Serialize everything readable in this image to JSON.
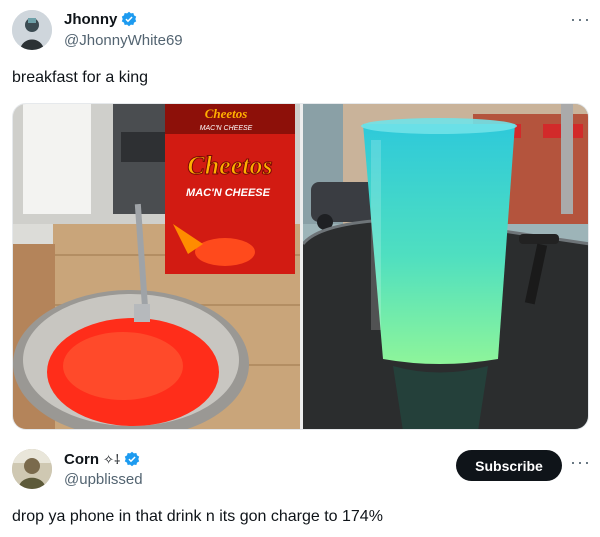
{
  "post": {
    "author_name": "Jhonny",
    "author_handle": "@JhonnyWhite69",
    "text": "breakfast for a king",
    "more_label": "···",
    "image_left": {
      "box_brand": "Cheetos",
      "box_small_brand": "Cheetos",
      "box_small_subtitle": "MAC'N CHEESE",
      "box_subtitle": "MAC'N CHEESE"
    }
  },
  "reply": {
    "author_name": "Corn",
    "author_suffix": "✧⸸",
    "author_handle": "@upblissed",
    "text": "drop ya phone in that drink n its gon charge to 174%",
    "subscribe_label": "Subscribe",
    "more_label": "···"
  },
  "colors": {
    "verified_blue": "#1d9bf0",
    "drink_top": "#33d2d8",
    "drink_bottom": "#7ef39a",
    "snack_red": "#ff2d1a",
    "box_red": "#d21b12"
  }
}
